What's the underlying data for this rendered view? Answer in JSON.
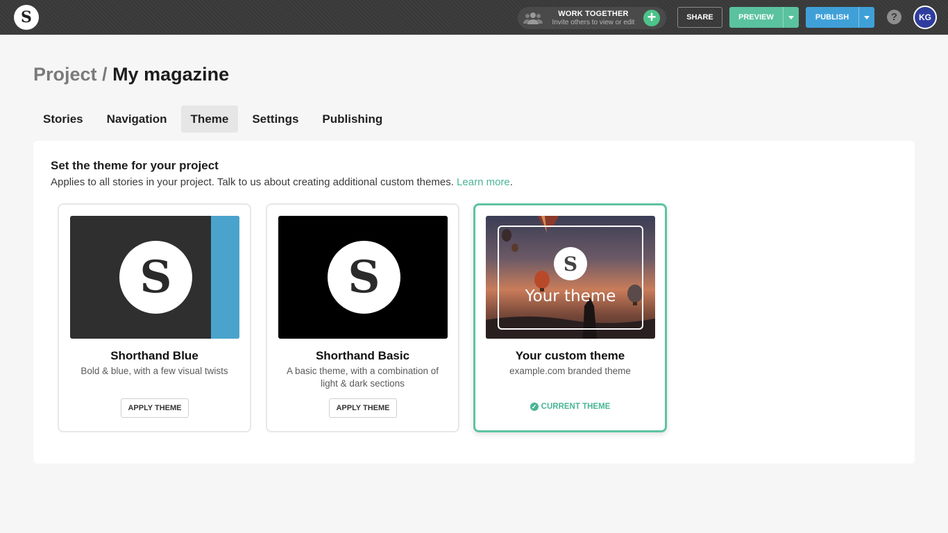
{
  "topbar": {
    "logo_letter": "S",
    "work_together": {
      "title": "WORK TOGETHER",
      "subtitle": "Invite others to view or edit",
      "icon": "people-icon",
      "add_icon": "plus-icon"
    },
    "share_label": "SHARE",
    "preview_label": "PREVIEW",
    "publish_label": "PUBLISH",
    "help_label": "?",
    "avatar_initials": "KG"
  },
  "header": {
    "prefix": "Project /",
    "project_name": "My magazine"
  },
  "tabs": [
    {
      "label": "Stories"
    },
    {
      "label": "Navigation"
    },
    {
      "label": "Theme"
    },
    {
      "label": "Settings"
    },
    {
      "label": "Publishing"
    }
  ],
  "active_tab": "Theme",
  "panel": {
    "heading": "Set the theme for your project",
    "subtext": "Applies to all stories in your project. Talk to us about creating additional custom themes.",
    "learn_more": "Learn more",
    "after_link": "."
  },
  "themes": [
    {
      "name": "Shorthand Blue",
      "description": "Bold & blue, with a few visual twists",
      "action": "APPLY THEME",
      "thumb_letter": "S",
      "accent": "#4aa3cc"
    },
    {
      "name": "Shorthand Basic",
      "description": "A basic theme, with a combination of light & dark sections",
      "action": "APPLY THEME",
      "thumb_letter": "S"
    },
    {
      "name": "Your custom theme",
      "description": "example.com branded theme",
      "status": "CURRENT THEME",
      "thumb_letter": "S",
      "thumb_text": "Your theme"
    }
  ],
  "colors": {
    "accent_green": "#4ab595",
    "preview": "#5ac29e",
    "publish": "#3fa0d8",
    "avatar": "#2f3d9e"
  }
}
